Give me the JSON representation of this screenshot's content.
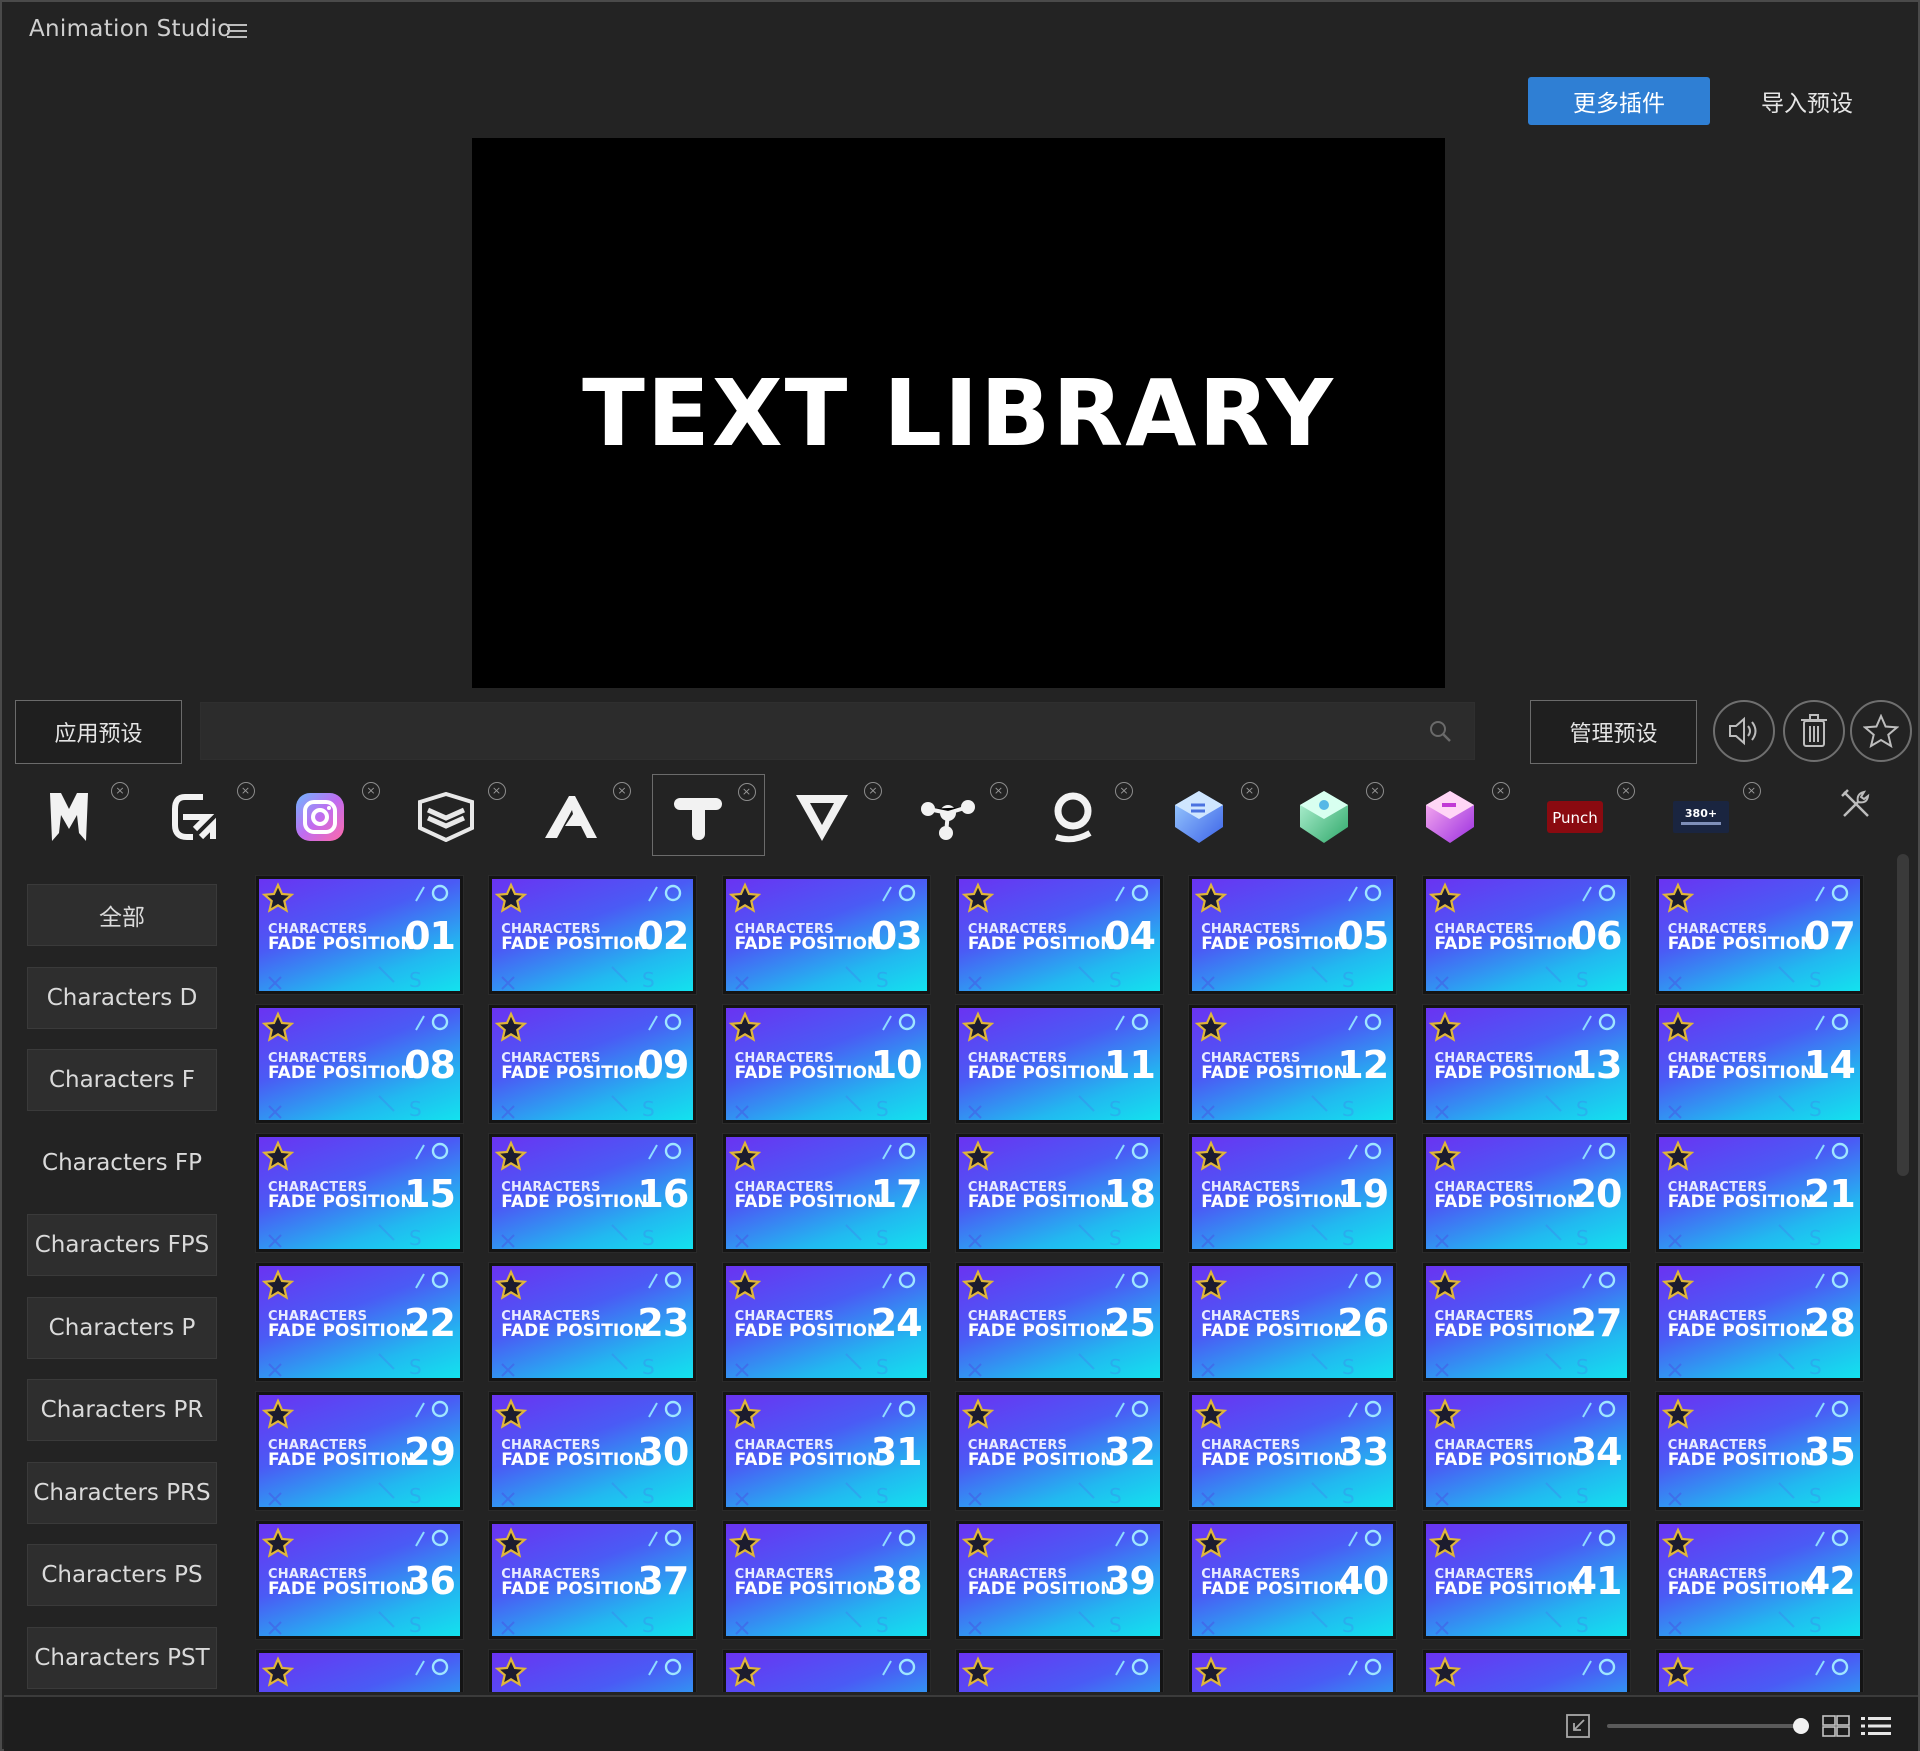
{
  "app": {
    "title": "Animation Studio"
  },
  "header": {
    "more_plugins": "更多插件",
    "import_preset": "导入预设"
  },
  "preview": {
    "text": "TEXT LIBRARY"
  },
  "toolbar": {
    "apply_preset": "应用预设",
    "search_placeholder": "",
    "manage_preset": "管理预设"
  },
  "plugins": [
    {
      "name": "M",
      "icon": "m-logo-icon"
    },
    {
      "name": "E",
      "icon": "e-logo-icon"
    },
    {
      "name": "Camera",
      "icon": "camera-logo-icon"
    },
    {
      "name": "Layers",
      "icon": "chevron-layers-logo-icon"
    },
    {
      "name": "A",
      "icon": "a-logo-icon"
    },
    {
      "name": "T",
      "icon": "t-logo-icon",
      "active": true
    },
    {
      "name": "V",
      "icon": "v-logo-icon"
    },
    {
      "name": "Nodes",
      "icon": "nodes-logo-icon"
    },
    {
      "name": "Ring",
      "icon": "ring-logo-icon"
    },
    {
      "name": "Box Blue",
      "icon": "box-blue-logo-icon"
    },
    {
      "name": "Box Green",
      "icon": "box-green-logo-icon"
    },
    {
      "name": "Box Pink",
      "icon": "box-pink-logo-icon"
    },
    {
      "name": "Punch",
      "icon": "punch-logo-icon",
      "label": "Punch"
    },
    {
      "name": "380+",
      "icon": "transitions-logo-icon",
      "label": "380+"
    }
  ],
  "sidebar": {
    "items": [
      {
        "label": "全部",
        "selected": false
      },
      {
        "label": "Characters D",
        "selected": false
      },
      {
        "label": "Characters F",
        "selected": false
      },
      {
        "label": "Characters FP",
        "selected": true
      },
      {
        "label": "Characters FPS",
        "selected": false
      },
      {
        "label": "Characters P",
        "selected": false
      },
      {
        "label": "Characters PR",
        "selected": false
      },
      {
        "label": "Characters PRS",
        "selected": false
      },
      {
        "label": "Characters PS",
        "selected": false
      },
      {
        "label": "Characters PST",
        "selected": false
      }
    ]
  },
  "presets": {
    "line1": "CHARACTERS",
    "line2": "FADE POSITION",
    "numbers": [
      "01",
      "02",
      "03",
      "04",
      "05",
      "06",
      "07",
      "08",
      "09",
      "10",
      "11",
      "12",
      "13",
      "14",
      "15",
      "16",
      "17",
      "18",
      "19",
      "20",
      "21",
      "22",
      "23",
      "24",
      "25",
      "26",
      "27",
      "28",
      "29",
      "30",
      "31",
      "32",
      "33",
      "34",
      "35",
      "36",
      "37",
      "38",
      "39",
      "40",
      "41",
      "42",
      "",
      "",
      "",
      "",
      "",
      "",
      ""
    ]
  },
  "colors": {
    "accent": "#2f7fd4",
    "background": "#232323",
    "card_top": "#6a33f2",
    "card_bottom": "#13e2ee",
    "star": "#e0b63a"
  }
}
